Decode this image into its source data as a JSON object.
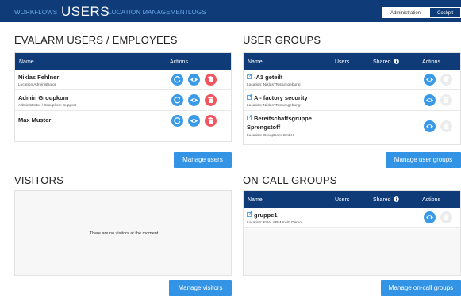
{
  "nav": {
    "items": [
      "WORKFLOWS",
      "USERS",
      "LOCATION MANAGEMENT",
      "LOGS"
    ],
    "admin_label": "Administration",
    "cockpit_label": "Cockpit"
  },
  "users": {
    "title": "EVALARM USERS / EMPLOYEES",
    "col_name": "Name",
    "col_actions": "Actions",
    "rows": [
      {
        "name": "Niklas Fehlner",
        "sub": "Location Administrator"
      },
      {
        "name": "Admin Groupkom",
        "sub": "Administrator / Groupkom Support"
      },
      {
        "name": "Max Muster",
        "sub": ""
      }
    ],
    "manage_label": "Manage users"
  },
  "groups": {
    "title": "USER GROUPS",
    "col_name": "Name",
    "col_users": "Users",
    "col_shared": "Shared",
    "col_actions": "Actions",
    "rows": [
      {
        "name": "-A1 geteilt",
        "sub": "Location: Niklas' Testumgebung"
      },
      {
        "name": "A - factory security",
        "sub": "Location: Niklas' Testumgebung"
      },
      {
        "name": "Bereitschaftsgruppe",
        "name2": "Sprengstoff",
        "sub": "Location: GroupKom GmbH"
      }
    ],
    "manage_label": "Manage user groups"
  },
  "visitors": {
    "title": "VISITORS",
    "empty": "There are no visitors at the moment",
    "manage_label": "Manage visitors"
  },
  "oncall": {
    "title": "ON-CALL GROUPS",
    "col_name": "Name",
    "col_users": "Users",
    "col_shared": "Shared",
    "col_actions": "Actions",
    "rows": [
      {
        "name": "gruppe1",
        "sub": "Location: EVALARM multi Demo"
      }
    ],
    "manage_label": "Manage on-call groups"
  },
  "colors": {
    "nav_bg": "#0f3c78",
    "accent": "#3394e6",
    "danger": "#f25560"
  },
  "icons": [
    "refresh-icon",
    "eye-icon",
    "trash-icon",
    "external-link-icon",
    "info-icon"
  ]
}
